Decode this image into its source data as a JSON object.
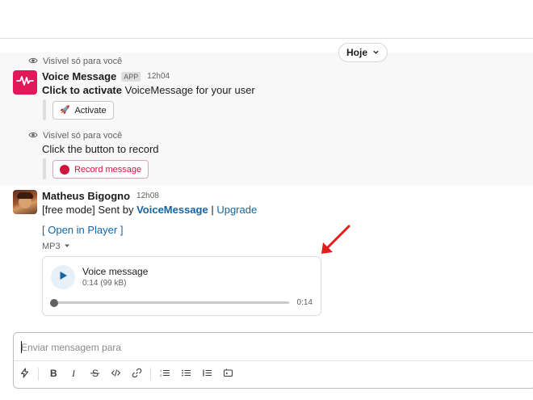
{
  "date_divider": {
    "label": "Hoje"
  },
  "ephemeral": {
    "note_1": "Visível só para você",
    "note_2": "Visível só para você"
  },
  "app_message": {
    "sender": "Voice Message",
    "badge": "APP",
    "time": "12h04",
    "text_bold": "Click to activate",
    "text_rest": " VoiceMessage for your user",
    "activate_label": "Activate",
    "prompt": "Click the button to record",
    "record_label": "Record message"
  },
  "user_message": {
    "sender": "Matheus Bigogno",
    "time": "12h08",
    "prefix": "[free mode] Sent by ",
    "brand": "VoiceMessage",
    "separator": " | ",
    "upgrade": "Upgrade",
    "open_player": "[ Open in Player ]",
    "file_type": "MP3"
  },
  "audio": {
    "title": "Voice message",
    "meta": "0:14 (99 kB)",
    "duration": "0:14",
    "progress": 0
  },
  "composer": {
    "placeholder": "Enviar mensagem para"
  },
  "icons": [
    "eye-icon",
    "chevron-down-icon",
    "waveform-icon",
    "rocket-icon",
    "record-dot-icon",
    "play-icon",
    "arrow-annotation-icon",
    "shortcuts-icon",
    "bold-icon",
    "italic-icon",
    "strikethrough-icon",
    "code-icon",
    "link-icon",
    "ordered-list-icon",
    "bulleted-list-icon",
    "blockquote-icon",
    "code-block-icon"
  ],
  "colors": {
    "accent_link": "#1264a3",
    "app_avatar": "#e2185a",
    "record_red": "#d0163f",
    "annotation_red": "#e21b1b",
    "ephemeral_bg": "#f8f8f8"
  }
}
